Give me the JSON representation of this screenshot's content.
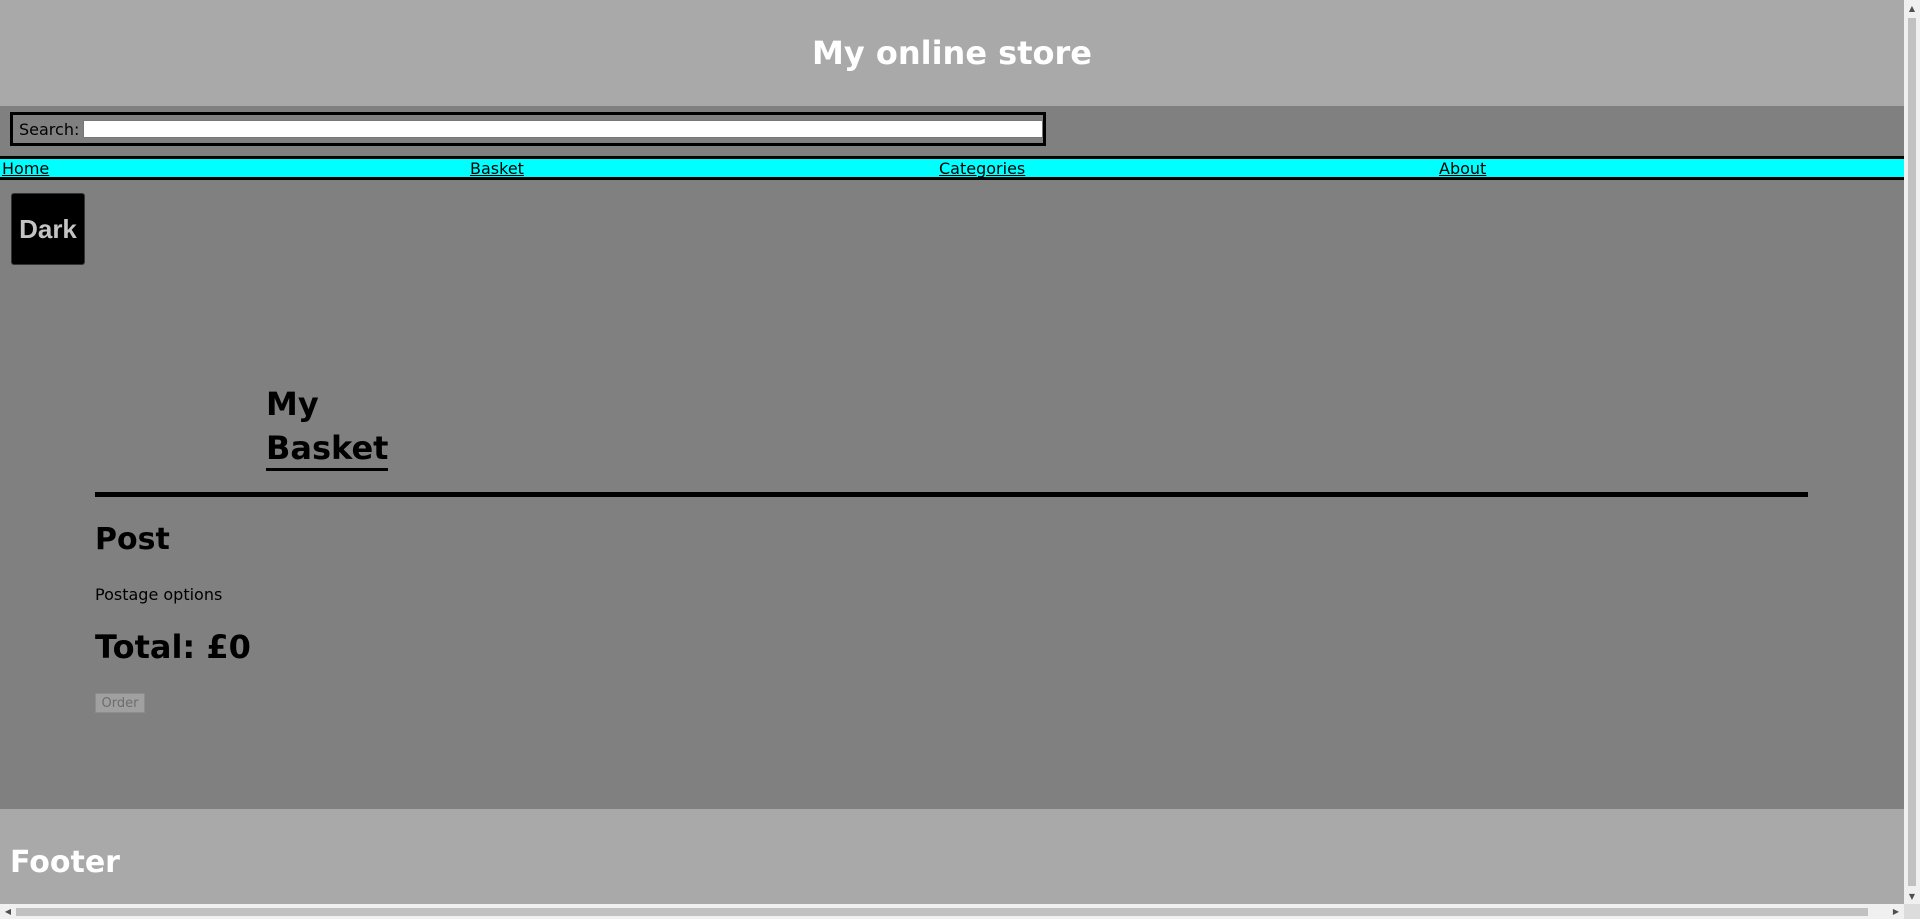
{
  "header": {
    "title": "My online store"
  },
  "search": {
    "label": "Search:",
    "value": "",
    "placeholder": ""
  },
  "nav": {
    "items": [
      {
        "label": "Home"
      },
      {
        "label": "Basket"
      },
      {
        "label": "Categories"
      },
      {
        "label": "About"
      }
    ]
  },
  "theme_toggle": {
    "label": "Dark"
  },
  "basket": {
    "title_line1": "My",
    "title_line2": "Basket",
    "post_heading": "Post",
    "postage_text": "Postage options",
    "total_label": "Total: £0",
    "order_label": "Order"
  },
  "footer": {
    "title": "Footer"
  },
  "colors": {
    "header_bg": "#a9a9a9",
    "body_bg": "#808080",
    "nav_bg": "#00ffff",
    "footer_bg": "#a9a9a9",
    "theme_button_bg": "#000000"
  },
  "icons": {
    "scroll_up": "chevron-up-icon",
    "scroll_down": "chevron-down-icon",
    "scroll_left": "chevron-left-icon",
    "scroll_right": "chevron-right-icon"
  }
}
